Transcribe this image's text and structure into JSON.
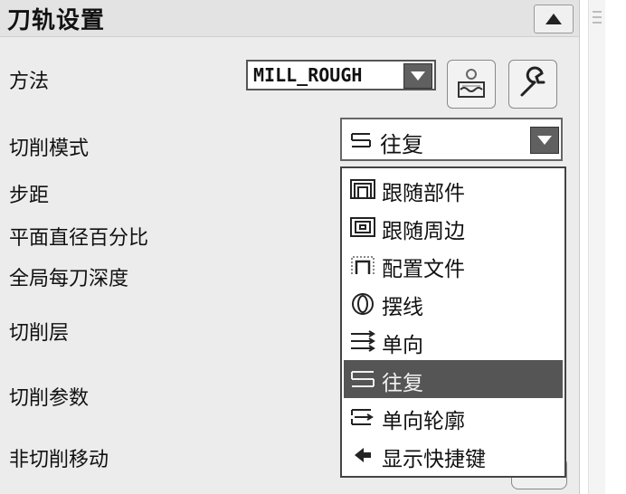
{
  "panel": {
    "title": "刀轨设置"
  },
  "fields": {
    "method": {
      "label": "方法",
      "value": "MILL_ROUGH"
    },
    "cut_pattern": {
      "label": "切削模式",
      "value": "往复"
    },
    "stepover": {
      "label": "步距"
    },
    "percent_flat_diameter": {
      "label": "平面直径百分比"
    },
    "global_depth": {
      "label": "全局每刀深度"
    },
    "cut_levels": {
      "label": "切削层"
    },
    "cutting_params": {
      "label": "切削参数"
    },
    "non_cutting_moves": {
      "label": "非切削移动"
    }
  },
  "dropdown": {
    "options": [
      {
        "label": "跟随部件",
        "icon": "follow-part-icon"
      },
      {
        "label": "跟随周边",
        "icon": "follow-periphery-icon"
      },
      {
        "label": "配置文件",
        "icon": "profile-icon"
      },
      {
        "label": "摆线",
        "icon": "trochoidal-icon"
      },
      {
        "label": "单向",
        "icon": "zig-icon"
      },
      {
        "label": "往复",
        "icon": "zig-zag-icon",
        "selected": true
      },
      {
        "label": "单向轮廓",
        "icon": "zig-with-contour-icon"
      },
      {
        "label": "显示快捷键",
        "icon": "show-shortcuts-icon"
      }
    ]
  },
  "colors": {
    "selected_bg": "#555555",
    "panel_bg": "#ececec"
  }
}
